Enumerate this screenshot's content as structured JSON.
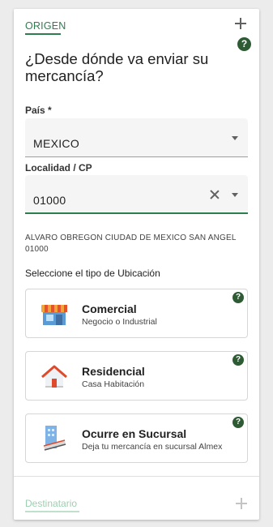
{
  "origin": {
    "tab_label": "ORIGEN",
    "help": "?",
    "heading": "¿Desde dónde va enviar su mercancía?",
    "country": {
      "label": "País *",
      "value": "MEXICO"
    },
    "locality": {
      "label": "Localidad / CP",
      "value": "01000"
    },
    "address": "ALVARO OBREGON CIUDAD DE MEXICO SAN ANGEL 01000",
    "location_type_title": "Seleccione el tipo de Ubicación",
    "options": [
      {
        "title": "Comercial",
        "subtitle": "Negocio o Industrial",
        "icon": "store-icon",
        "help": "?"
      },
      {
        "title": "Residencial",
        "subtitle": "Casa Habitación",
        "icon": "house-icon",
        "help": "?"
      },
      {
        "title": "Ocurre en Sucursal",
        "subtitle": "Deja tu mercancía en sucursal Almex",
        "icon": "branch-office-icon",
        "help": "?"
      }
    ]
  },
  "destination": {
    "tab_label": "Destinatario"
  },
  "colors": {
    "accent": "#2e7d4f",
    "help_badge": "#2e5b34",
    "destination_tab": "#9ecfb1"
  }
}
